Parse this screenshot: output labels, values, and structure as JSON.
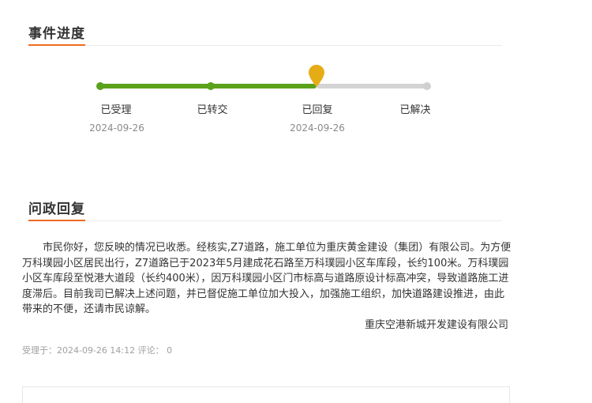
{
  "progress": {
    "title": "事件进度",
    "steps": [
      {
        "label": "已受理",
        "date": "2024-09-26",
        "status": "done"
      },
      {
        "label": "已转交",
        "date": "",
        "status": "done"
      },
      {
        "label": "已回复",
        "date": "2024-09-26",
        "status": "current"
      },
      {
        "label": "已解决",
        "date": "",
        "status": "pending"
      }
    ],
    "colors": {
      "done": "#5aa21a",
      "pending": "#d4d4d4",
      "current_marker": "#e6ac16",
      "accent": "#ee6a22"
    }
  },
  "reply": {
    "title": "问政回复",
    "body": "市民你好，您反映的情况已收悉。经核实,Z7道路，施工单位为重庆黄金建设（集团）有限公司。为方便万科璞园小区居民出行，Z7道路已于2023年5月建成花石路至万科璞园小区车库段，长约100米。万科璞园小区车库段至悦港大道段（长约400米），因万科璞园小区门市标高与道路原设计标高冲突，导致道路施工进度滞后。目前我司已解决上述问题，并已督促施工单位加大投入，加强施工组织，加快道路建设推进，由此带来的不便，还请市民谅解。",
    "signature": "重庆空港新城开发建设有限公司",
    "meta": "受理于：2024-09-26 14:12 评论：  0"
  }
}
